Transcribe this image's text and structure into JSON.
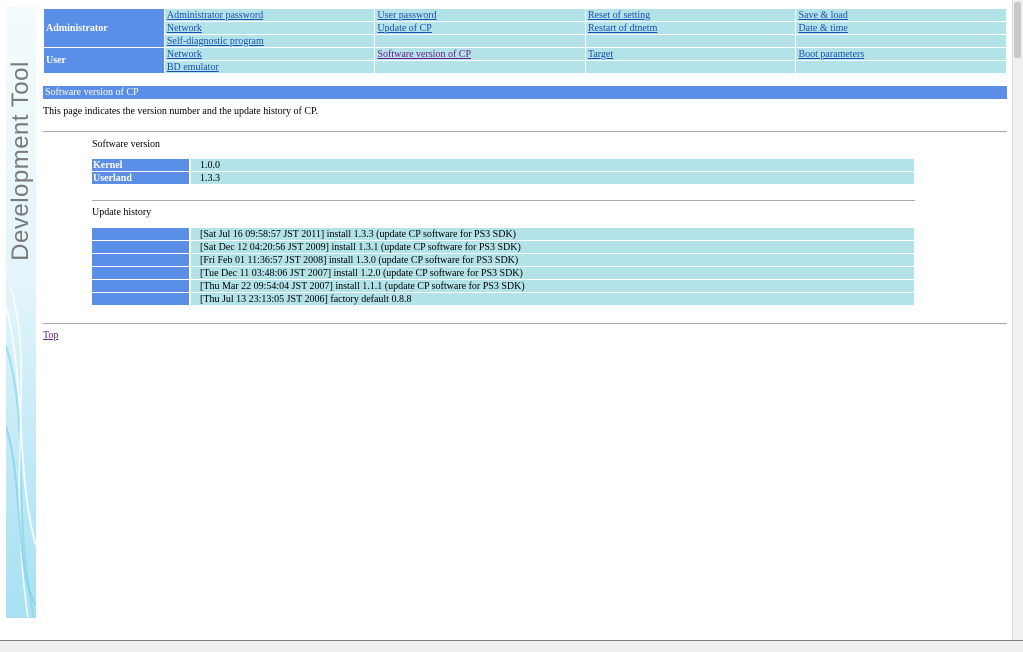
{
  "sidebar_title": "Development Tool",
  "nav": {
    "rows": [
      {
        "role": "Administrator",
        "links": [
          [
            "Administrator password",
            "User password",
            "Reset of setting",
            "Save & load"
          ],
          [
            "Network",
            "Update of CP",
            "Restart of dtnetm",
            "Date & time"
          ],
          [
            "Self-diagnostic program",
            "",
            "",
            ""
          ]
        ]
      },
      {
        "role": "User",
        "links": [
          [
            "Network",
            "Software version of CP",
            "Target",
            "Boot parameters"
          ],
          [
            "BD emulator",
            "",
            "",
            ""
          ]
        ]
      }
    ]
  },
  "section": {
    "title": "Software version of CP",
    "description": "This page indicates the version number and the update history of CP."
  },
  "software_version": {
    "heading": "Software version",
    "rows": [
      {
        "key": "Kernel",
        "value": "1.0.0"
      },
      {
        "key": "Userland",
        "value": "1.3.3"
      }
    ]
  },
  "update_history": {
    "heading": "Update history",
    "rows": [
      "[Sat Jul 16 09:58:57 JST 2011] install 1.3.3 (update CP software for PS3 SDK)",
      "[Sat Dec 12 04:20:56 JST 2009] install 1.3.1 (update CP software for PS3 SDK)",
      "[Fri Feb 01 11:36:57 JST 2008] install 1.3.0 (update CP software for PS3 SDK)",
      "[Tue Dec 11 03:48:06 JST 2007] install 1.2.0 (update CP software for PS3 SDK)",
      "[Thu Mar 22 09:54:04 JST 2007] install 1.1.1 (update CP software for PS3 SDK)",
      "[Thu Jul 13 23:13:05 JST 2006] factory default 0.8.8"
    ]
  },
  "top_link": "Top"
}
